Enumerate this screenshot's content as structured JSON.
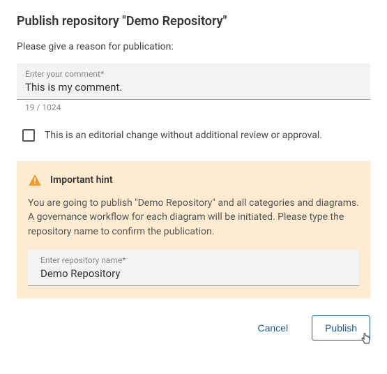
{
  "dialog": {
    "title": "Publish repository \"Demo Repository\"",
    "subtitle": "Please give a reason for publication:"
  },
  "comment": {
    "label": "Enter your comment*",
    "value": "This is my comment.",
    "count": "19 / 1024"
  },
  "editorial": {
    "label": "This is an editorial change without additional review or approval."
  },
  "hint": {
    "title": "Important hint",
    "text": "You are going to publish \"Demo Repository\" and all categories and diagrams. A governance workflow for each diagram will be initiated. Please type the repository name to confirm the publication.",
    "input_label": "Enter repository name*",
    "input_value": "Demo Repository"
  },
  "footer": {
    "cancel": "Cancel",
    "publish": "Publish"
  }
}
